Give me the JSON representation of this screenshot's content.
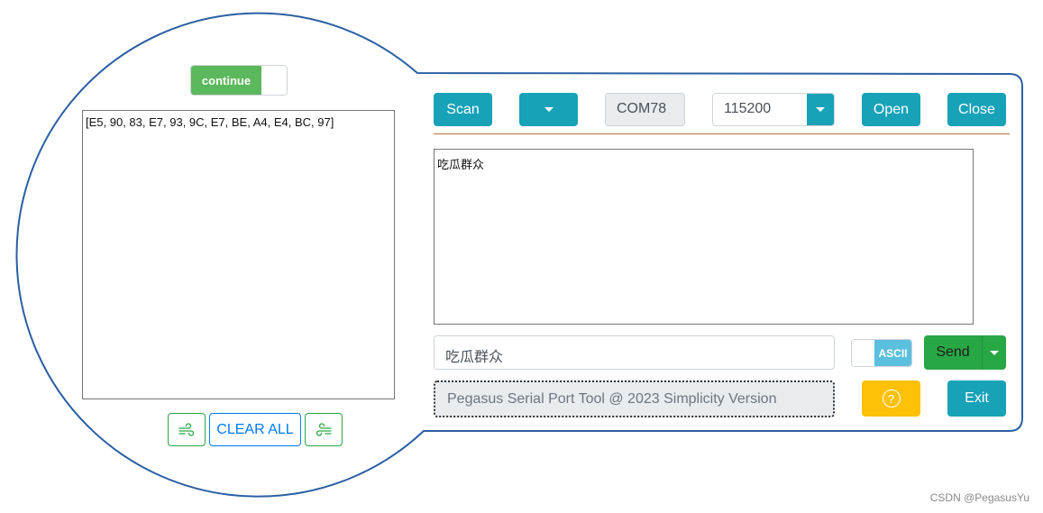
{
  "left_panel": {
    "continue_toggle_label": "continue",
    "received_hex": "[E5, 90, 83, E7, 93, 9C, E7, BE, A4, E4, BC, 97]",
    "clear_all_label": "CLEAR ALL",
    "left_icon": "wind-icon",
    "right_icon": "wind-icon"
  },
  "toolbar": {
    "scan_label": "Scan",
    "port_value": "COM78",
    "baud_value": "115200",
    "open_label": "Open",
    "close_label": "Close"
  },
  "receive": {
    "text": "吃瓜群众"
  },
  "send": {
    "input_value": "吃瓜群众",
    "mode_label": "ASCII",
    "send_label": "Send"
  },
  "footer": {
    "status_text": "Pegasus Serial Port Tool @ 2023 Simplicity Version",
    "help_symbol": "?",
    "exit_label": "Exit"
  },
  "watermark": "CSDN @PegasusYu",
  "colors": {
    "info": "#17a2b8",
    "success": "#28a745",
    "success_light": "#5cb85c",
    "warning": "#ffc107",
    "primary": "#007bff",
    "outline": "#2b5fa3"
  }
}
